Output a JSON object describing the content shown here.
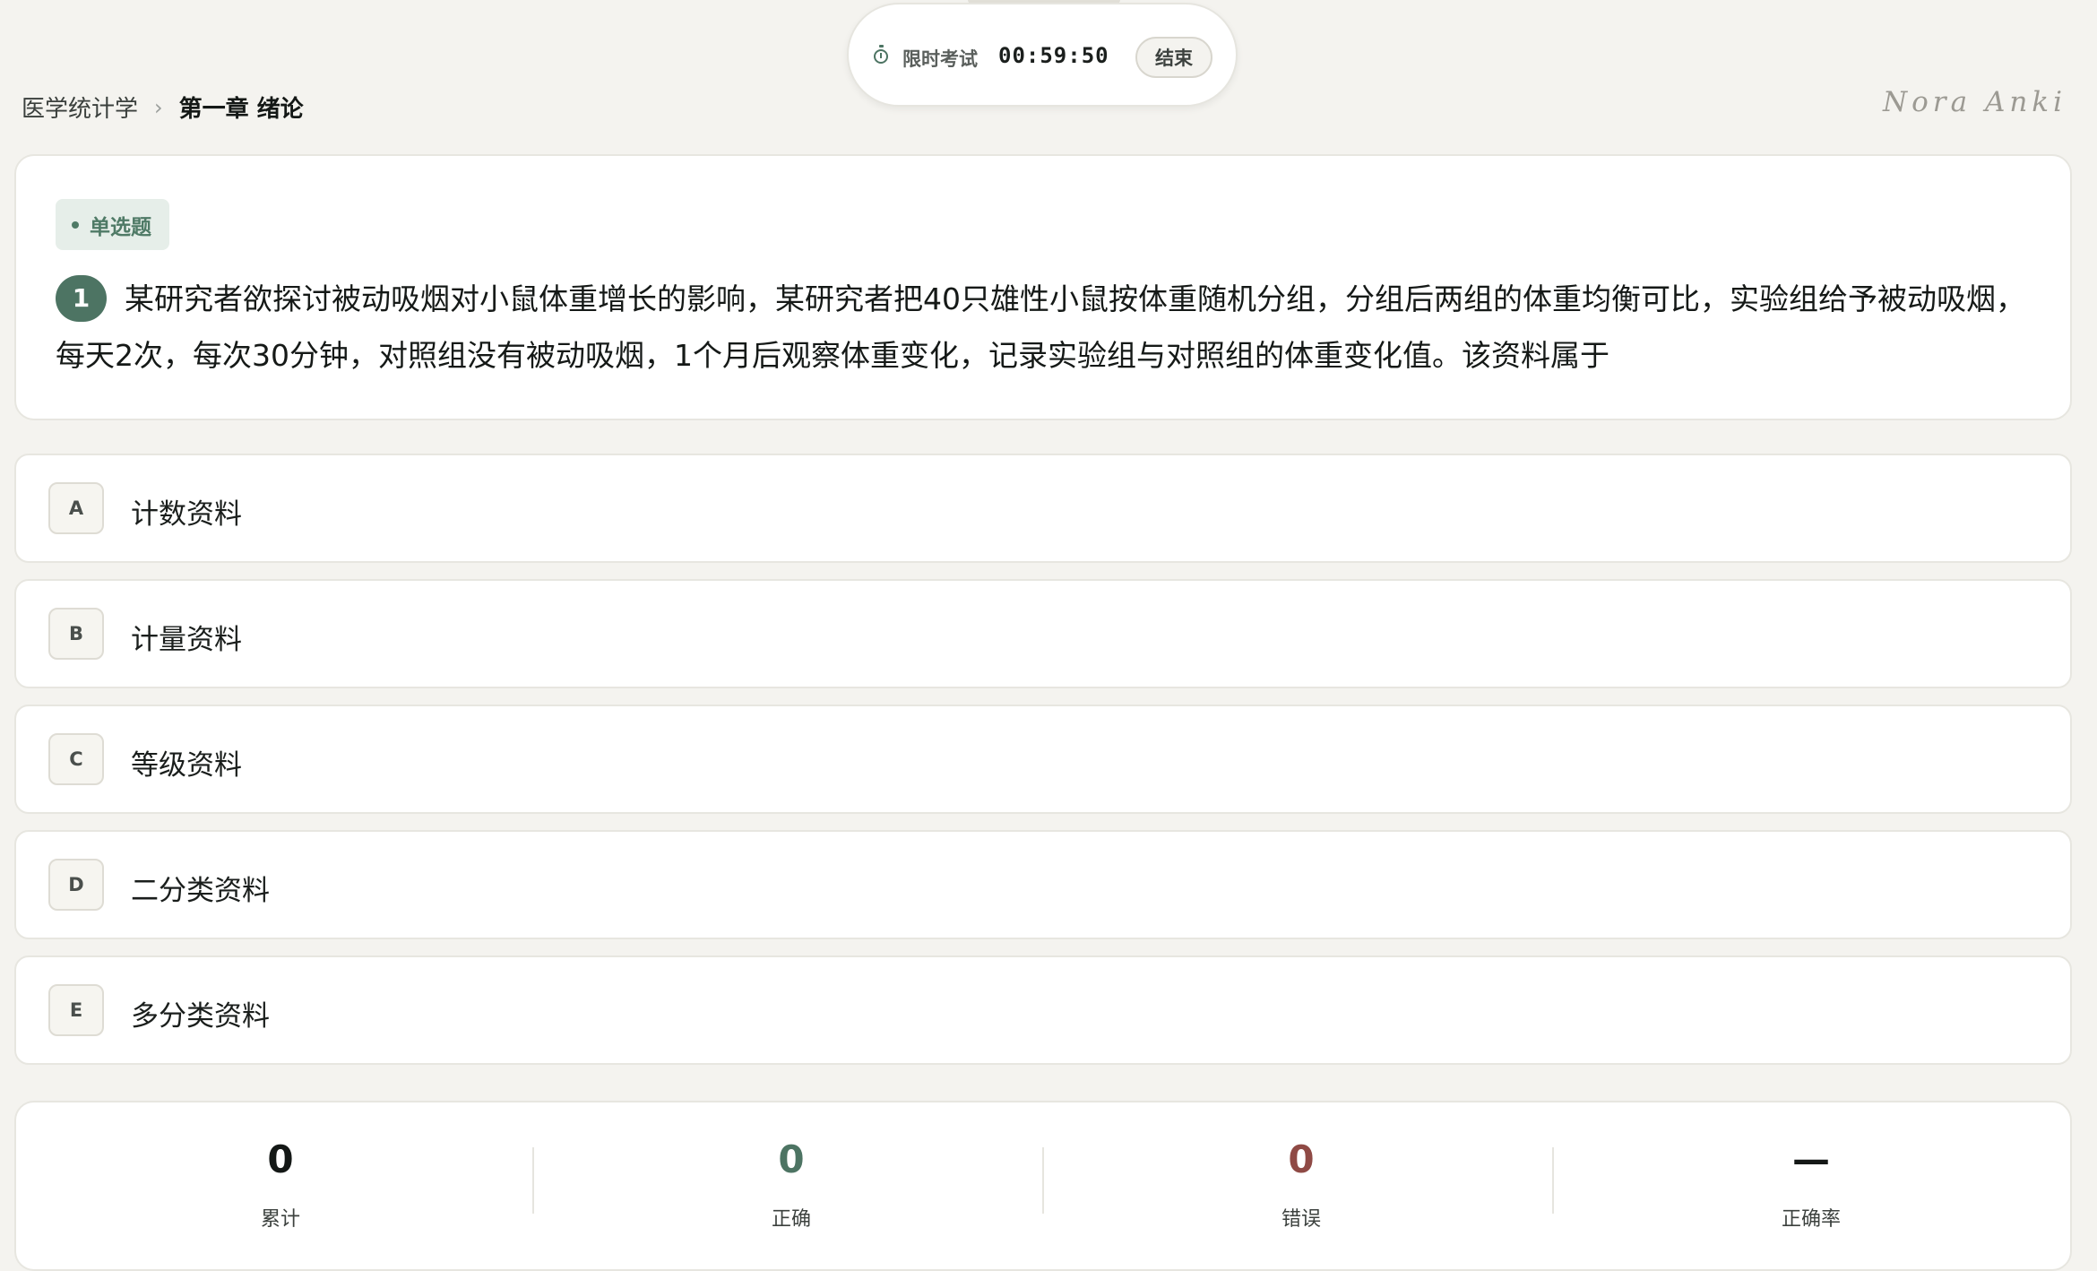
{
  "timer": {
    "label": "限时考试",
    "value": "00:59:50",
    "end_label": "结束"
  },
  "breadcrumb": {
    "parent": "医学统计学",
    "separator": "›",
    "current": "第一章 绪论"
  },
  "brand": "Nora Anki",
  "question": {
    "type": "单选题",
    "number": "1",
    "text": "某研究者欲探讨被动吸烟对小鼠体重增长的影响，某研究者把40只雄性小鼠按体重随机分组，分组后两组的体重均衡可比，实验组给予被动吸烟，每天2次，每次30分钟，对照组没有被动吸烟，1个月后观察体重变化，记录实验组与对照组的体重变化值。该资料属于"
  },
  "options": [
    {
      "letter": "A",
      "text": "计数资料"
    },
    {
      "letter": "B",
      "text": "计量资料"
    },
    {
      "letter": "C",
      "text": "等级资料"
    },
    {
      "letter": "D",
      "text": "二分类资料"
    },
    {
      "letter": "E",
      "text": "多分类资料"
    }
  ],
  "stats": {
    "total": {
      "value": "0",
      "label": "累计"
    },
    "correct": {
      "value": "0",
      "label": "正确"
    },
    "wrong": {
      "value": "0",
      "label": "错误"
    },
    "accuracy": {
      "value": "—",
      "label": "正确率"
    }
  },
  "colors": {
    "accent": "#4d7463",
    "correct": "#4d7463",
    "wrong": "#8f4a45",
    "background": "#f4f3ef"
  }
}
